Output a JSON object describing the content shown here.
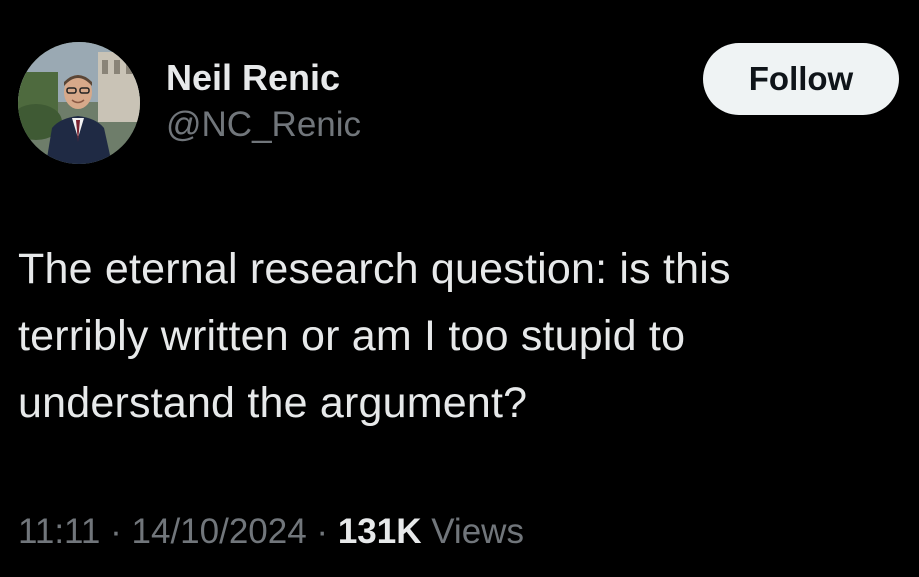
{
  "author": {
    "display_name": "Neil Renic",
    "handle": "@NC_Renic"
  },
  "follow_button": {
    "label": "Follow"
  },
  "tweet": {
    "text_lines": [
      "The eternal research question: is this",
      "terribly written or am I too stupid to",
      "understand the argument?"
    ]
  },
  "meta": {
    "time": "11:11",
    "separator": "·",
    "date": "14/10/2024",
    "views_count": "131K",
    "views_label": "Views"
  },
  "colors": {
    "background": "#000000",
    "primary_text": "#e7e9ea",
    "secondary_text": "#71767b",
    "follow_button_bg": "#eff3f4",
    "follow_button_text": "#0f1419"
  },
  "icons": {
    "avatar": "profile-photo-avatar"
  }
}
